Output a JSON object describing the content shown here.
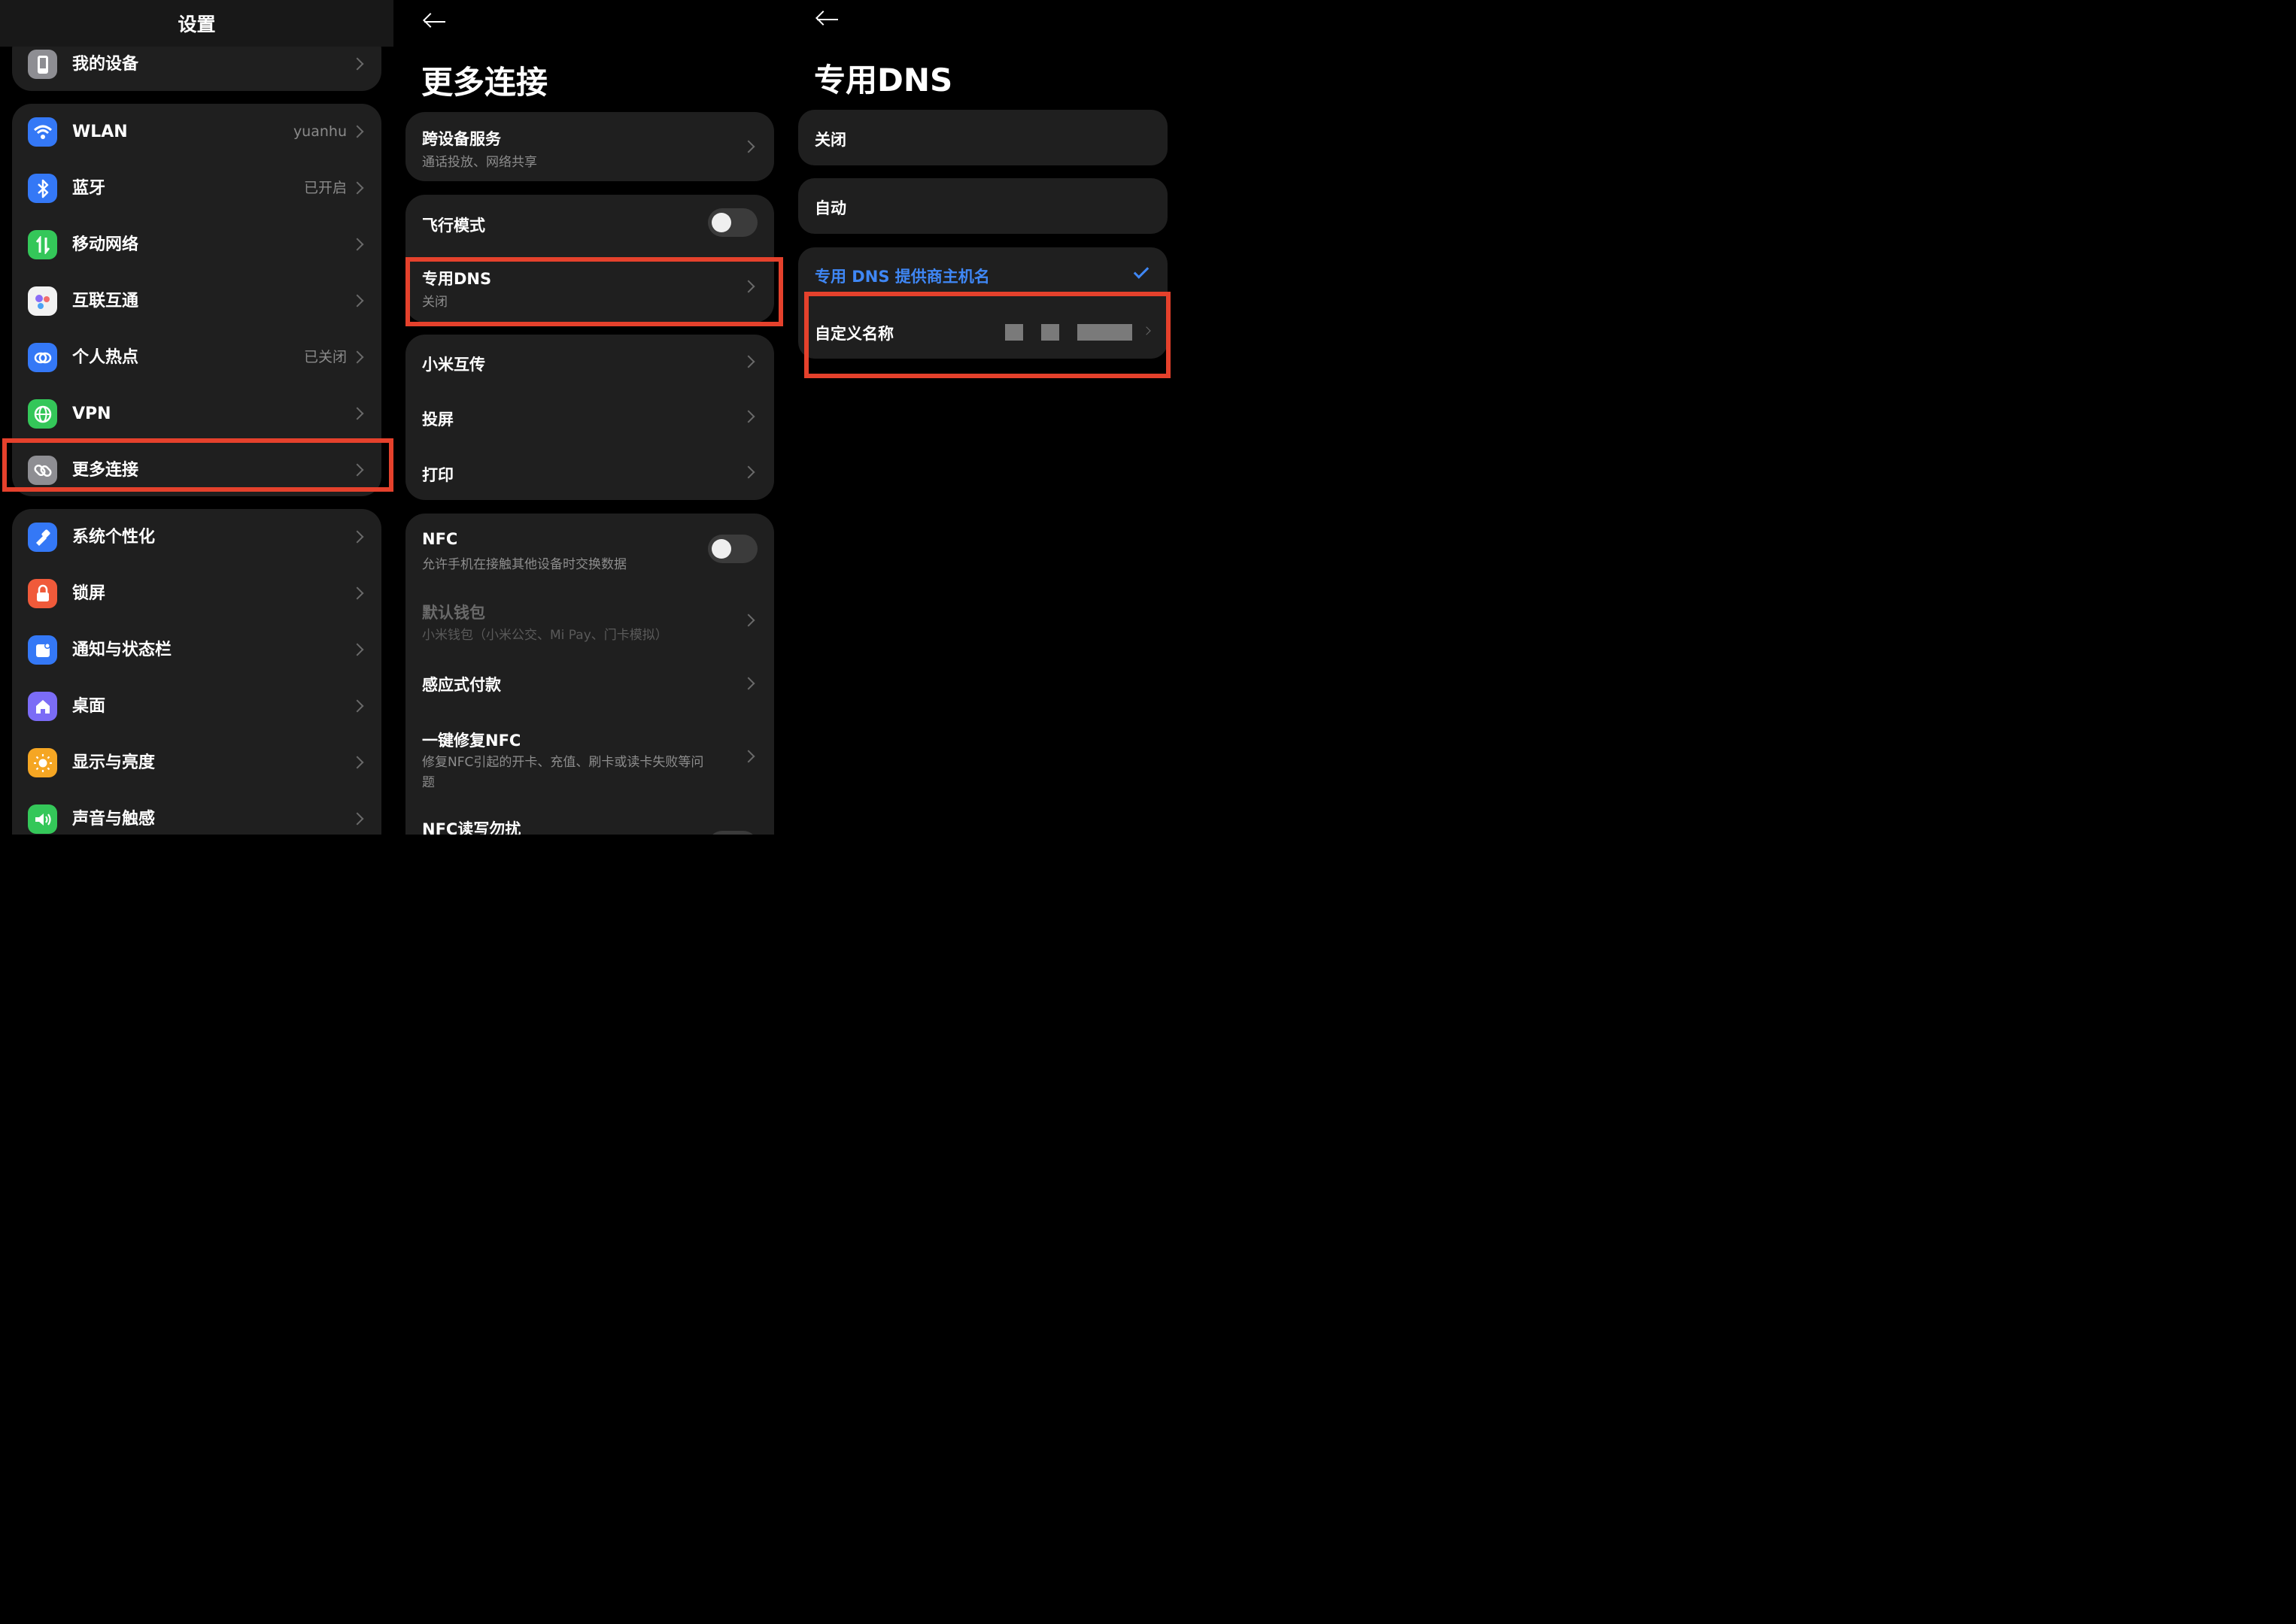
{
  "colors": {
    "background": "#000000",
    "card": "#1f1f1f",
    "highlight": "#e5412c",
    "accent_blue": "#3f87f5"
  },
  "settings": {
    "title": "设置",
    "top_item": {
      "label": "我的设备",
      "icon": "phone-icon"
    },
    "connectivity": [
      {
        "label": "WLAN",
        "value": "yuanhu",
        "icon": "wifi-icon",
        "color": "#3478f6"
      },
      {
        "label": "蓝牙",
        "value": "已开启",
        "icon": "bluetooth-icon",
        "color": "#3478f6"
      },
      {
        "label": "移动网络",
        "value": "",
        "icon": "mobile-data-icon",
        "color": "#34c759"
      },
      {
        "label": "互联互通",
        "value": "",
        "icon": "interconnect-icon",
        "color": "#f2f2f2"
      },
      {
        "label": "个人热点",
        "value": "已关闭",
        "icon": "hotspot-icon",
        "color": "#3478f6"
      },
      {
        "label": "VPN",
        "value": "",
        "icon": "vpn-icon",
        "color": "#34c759"
      },
      {
        "label": "更多连接",
        "value": "",
        "icon": "link-icon",
        "color": "#8e8e93"
      }
    ],
    "personal": [
      {
        "label": "系统个性化",
        "icon": "brush-icon",
        "color": "#3478f6"
      },
      {
        "label": "锁屏",
        "icon": "lock-icon",
        "color": "#f05a3a"
      },
      {
        "label": "通知与状态栏",
        "icon": "notification-icon",
        "color": "#3478f6"
      },
      {
        "label": "桌面",
        "icon": "home-icon",
        "color": "#7b6cf6"
      },
      {
        "label": "显示与亮度",
        "icon": "sun-icon",
        "color": "#f5a623"
      },
      {
        "label": "声音与触感",
        "icon": "speaker-icon",
        "color": "#34c759"
      }
    ]
  },
  "more_connections": {
    "title": "更多连接",
    "cross_device": {
      "title": "跨设备服务",
      "subtitle": "通话投放、网络共享"
    },
    "airplane": {
      "title": "飞行模式",
      "on": false
    },
    "private_dns": {
      "title": "专用DNS",
      "subtitle": "关闭"
    },
    "group3": [
      "小米互传",
      "投屏",
      "打印"
    ],
    "nfc": {
      "title": "NFC",
      "subtitle": "允许手机在接触其他设备时交换数据",
      "on": false
    },
    "default_wallet": {
      "title": "默认钱包",
      "subtitle": "小米钱包（小米公交、Mi Pay、门卡模拟）"
    },
    "tap_pay": {
      "title": "感应式付款"
    },
    "repair_nfc": {
      "title": "一键修复NFC",
      "subtitle_line1": "修复NFC引起的开卡、充值、刷卡或读卡失败等问",
      "subtitle_line2": "题"
    },
    "nfc_rw": {
      "title": "NFC读写勿扰"
    }
  },
  "private_dns_page": {
    "title": "专用DNS",
    "options": [
      "关闭",
      "自动"
    ],
    "provider_label": "专用 DNS 提供商主机名",
    "custom_name_label": "自定义名称"
  }
}
